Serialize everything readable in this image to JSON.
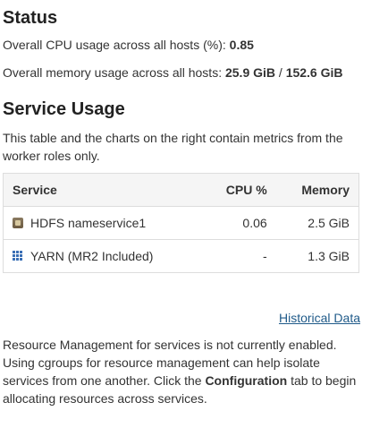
{
  "status": {
    "heading": "Status",
    "cpu_label": "Overall CPU usage across all hosts (%):",
    "cpu_value": "0.85",
    "mem_label": "Overall memory usage across all hosts:",
    "mem_used": "25.9 GiB",
    "mem_sep": "/",
    "mem_total": "152.6 GiB"
  },
  "service_usage": {
    "heading": "Service Usage",
    "description": "This table and the charts on the right contain metrics from the worker roles only.",
    "columns": [
      "Service",
      "CPU %",
      "Memory"
    ],
    "rows": [
      {
        "icon": "hdfs-icon",
        "service": "HDFS nameservice1",
        "cpu": "0.06",
        "memory": "2.5 GiB"
      },
      {
        "icon": "yarn-icon",
        "service": "YARN (MR2 Included)",
        "cpu": "-",
        "memory": "1.3 GiB"
      }
    ]
  },
  "historical_link": "Historical Data",
  "note": {
    "before": "Resource Management for services is not currently enabled. Using cgroups for resource management can help isolate services from one another. Click the ",
    "bold": "Configuration",
    "after": " tab to begin allocating resources across services."
  }
}
